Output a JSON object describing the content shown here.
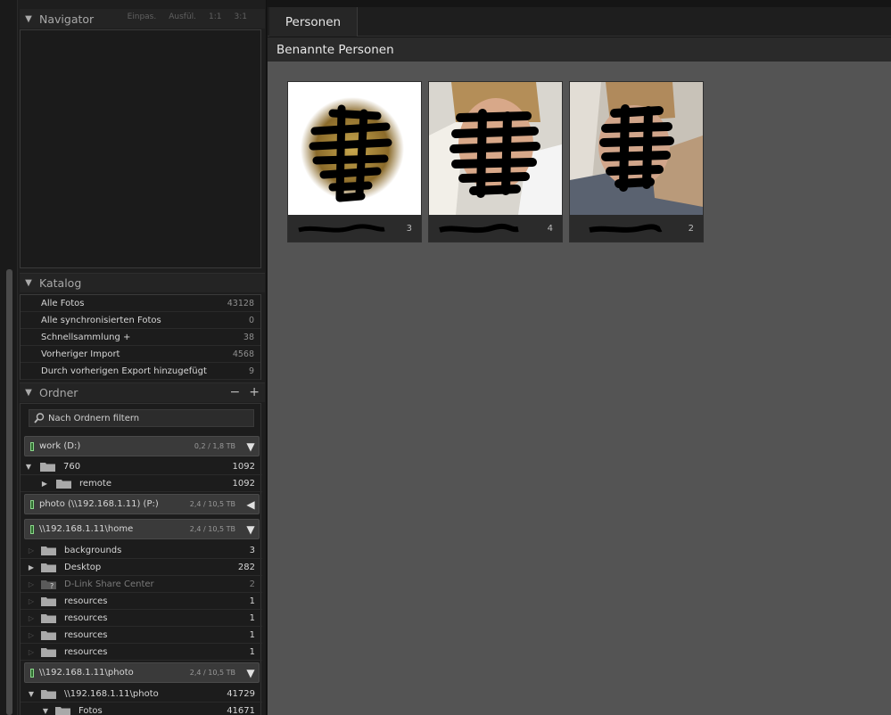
{
  "navigator": {
    "title": "Navigator",
    "modes": [
      "Einpas.",
      "Ausfül.",
      "1:1",
      "3:1"
    ]
  },
  "katalog": {
    "title": "Katalog",
    "items": [
      {
        "label": "Alle Fotos",
        "count": "43128"
      },
      {
        "label": "Alle synchronisierten Fotos",
        "count": "0"
      },
      {
        "label": "Schnellsammlung +",
        "count": "38"
      },
      {
        "label": "Vorheriger Import",
        "count": "4568"
      },
      {
        "label": "Durch vorherigen Export hinzugefügt",
        "count": "9"
      }
    ]
  },
  "ordner": {
    "title": "Ordner",
    "remove_label": "−",
    "add_label": "+",
    "filter_placeholder": "Nach Ordnern filtern",
    "volumes": [
      {
        "name": "work (D:)",
        "size": "0,2 / 1,8 TB"
      },
      {
        "name": "photo (\\\\192.168.1.11) (P:)",
        "size": "2,4 / 10,5 TB"
      },
      {
        "name": "\\\\192.168.1.11\\home",
        "size": "2,4 / 10,5 TB"
      },
      {
        "name": "\\\\192.168.1.11\\photo",
        "size": "2,4 / 10,5 TB"
      }
    ],
    "folders_work": [
      {
        "name": "760",
        "count": "1092"
      },
      {
        "name": "remote",
        "count": "1092"
      }
    ],
    "folders_home": [
      {
        "name": "backgrounds",
        "count": "3"
      },
      {
        "name": "Desktop",
        "count": "282"
      },
      {
        "name": "D-Link Share Center",
        "count": "2"
      },
      {
        "name": "resources",
        "count": "1"
      },
      {
        "name": "resources",
        "count": "1"
      },
      {
        "name": "resources",
        "count": "1"
      },
      {
        "name": "resources",
        "count": "1"
      }
    ],
    "folders_photo": [
      {
        "name": "\\\\192.168.1.11\\photo",
        "count": "41729"
      },
      {
        "name": "Fotos",
        "count": "41671"
      }
    ]
  },
  "main": {
    "tab": "Personen",
    "section": "Benannte Personen",
    "people": [
      {
        "count": "3"
      },
      {
        "count": "4"
      },
      {
        "count": "2"
      }
    ]
  },
  "colors": {
    "grid_bg": "#545454",
    "panel_bg": "#1e1e1e",
    "drive_led": "#8ad68a"
  }
}
